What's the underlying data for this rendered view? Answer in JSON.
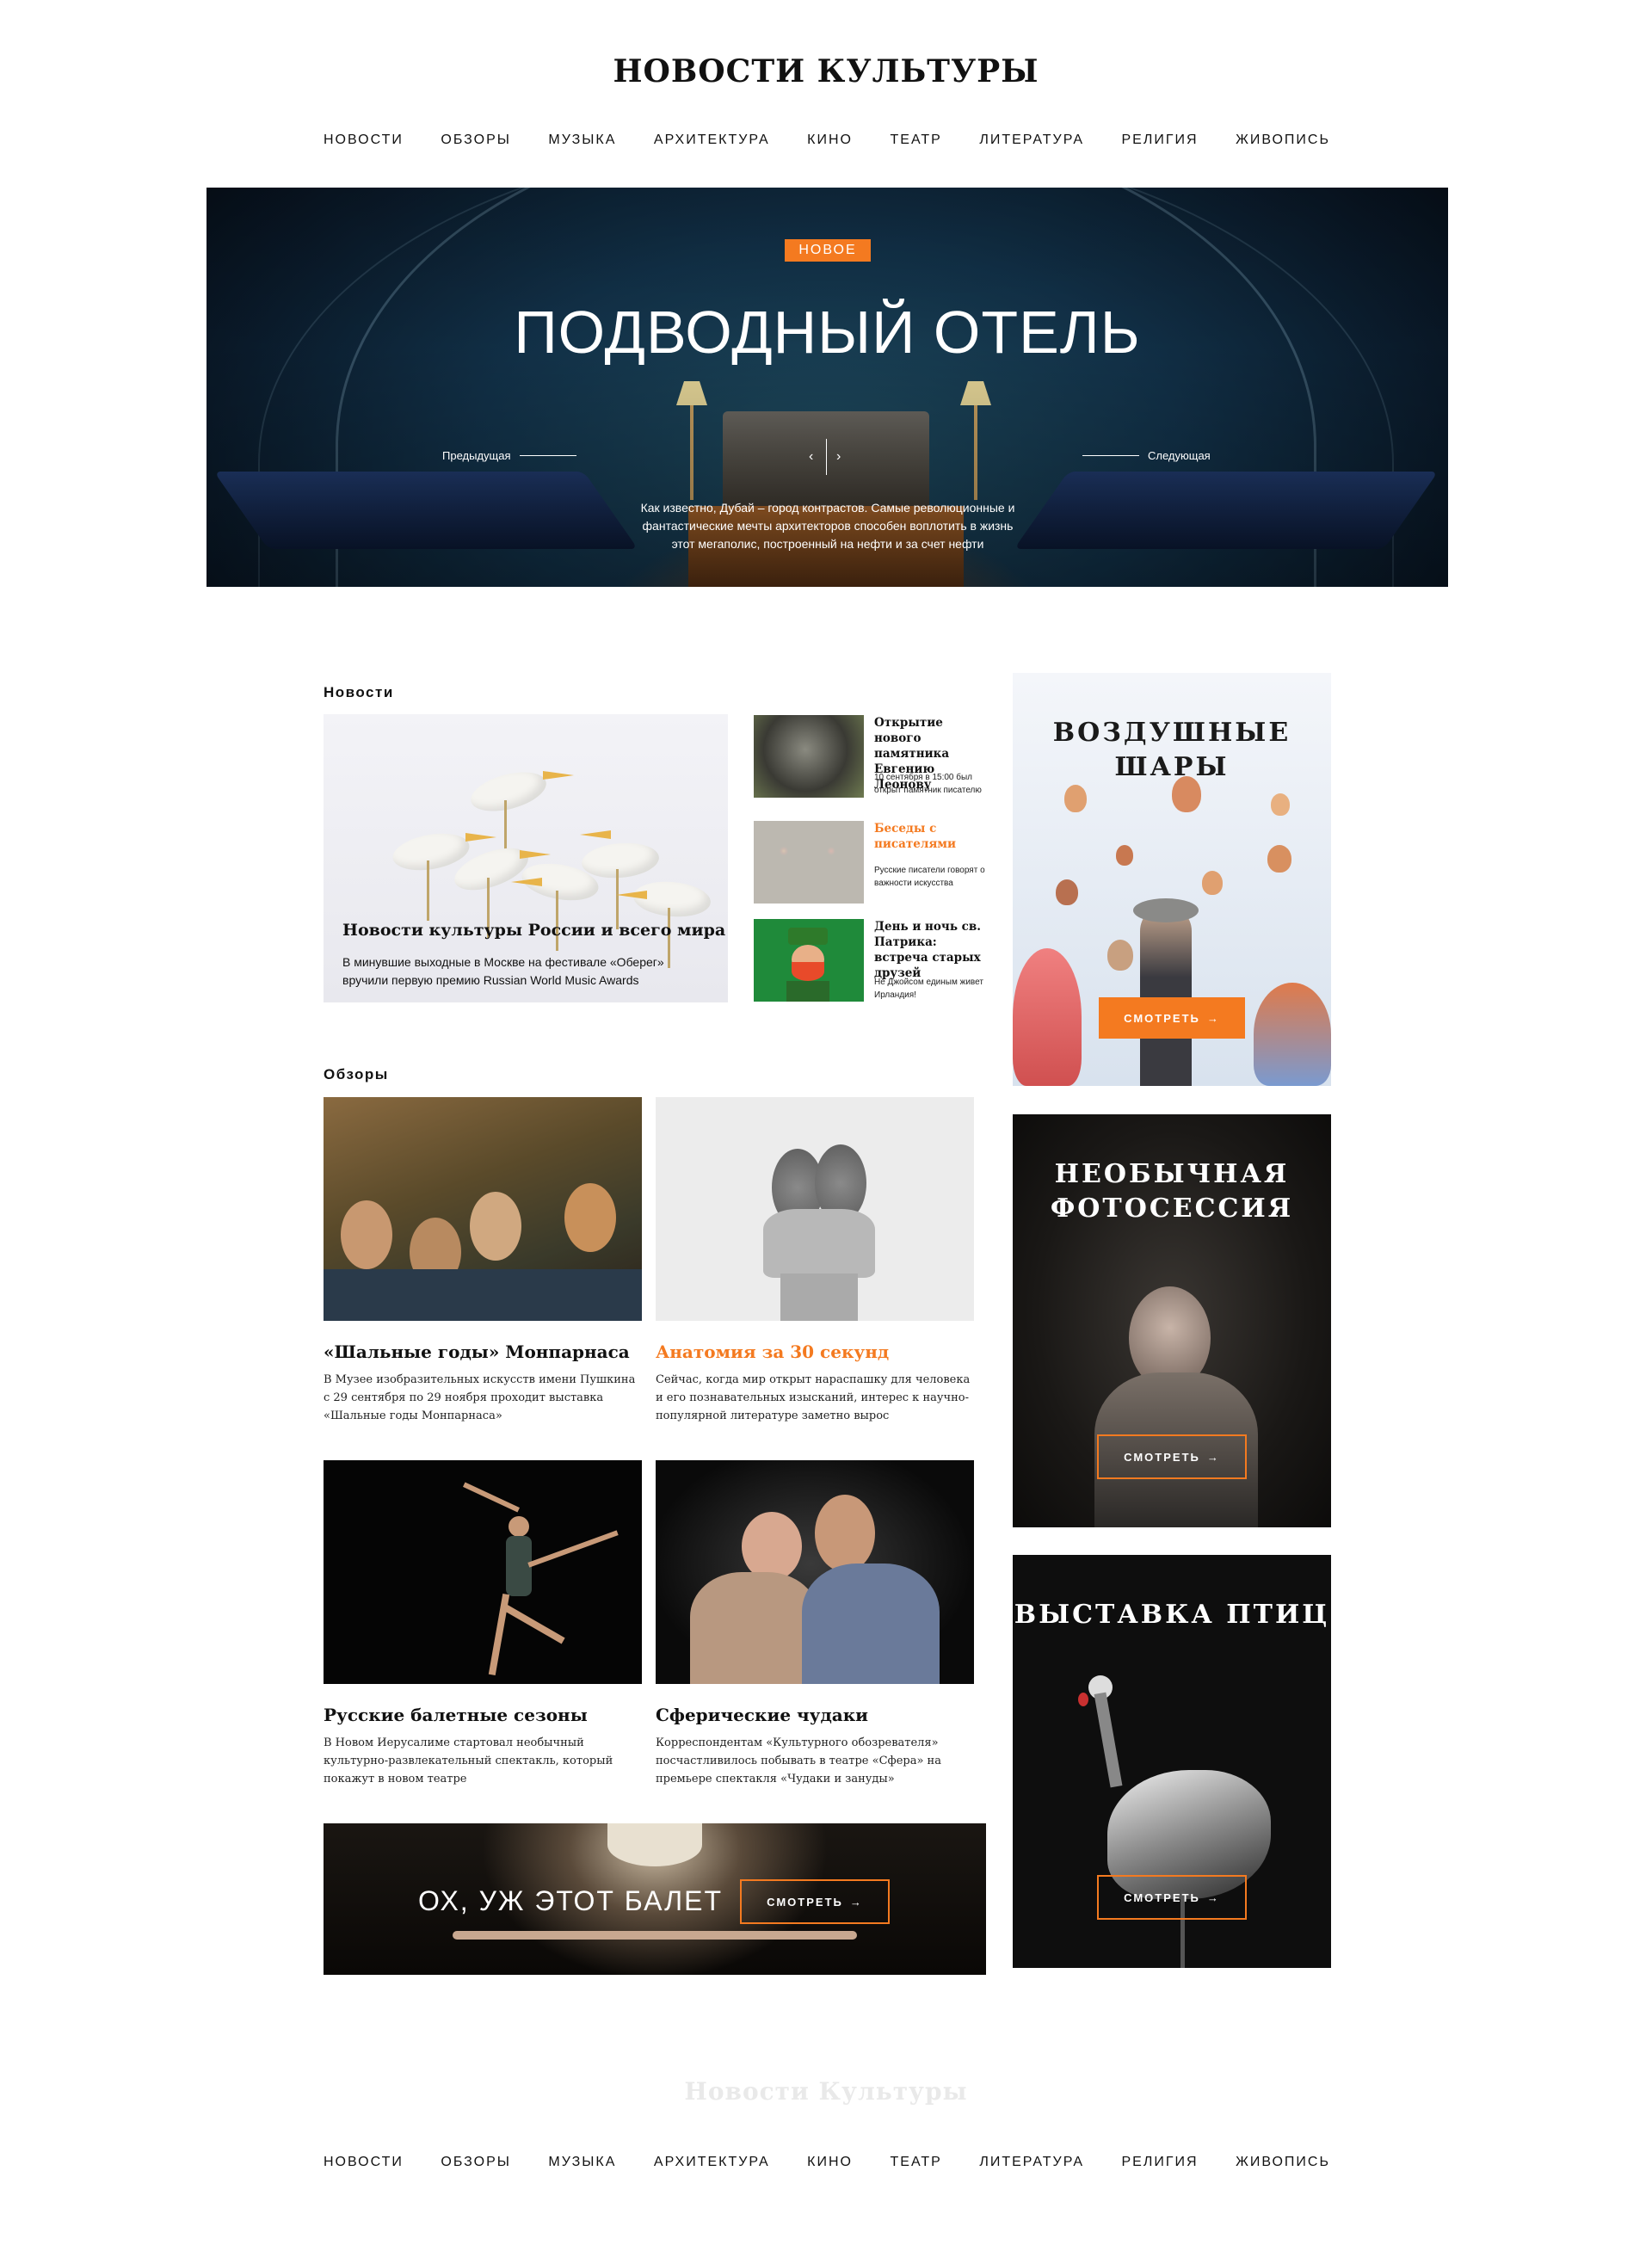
{
  "header": {
    "site_title": "НОВОСТИ КУЛЬТУРЫ"
  },
  "nav": [
    "НОВОСТИ",
    "ОБЗОРЫ",
    "МУЗЫКА",
    "АРХИТЕКТУРА",
    "КИНО",
    "ТЕАТР",
    "ЛИТЕРАТУРА",
    "РЕЛИГИЯ",
    "ЖИВОПИСЬ"
  ],
  "hero": {
    "badge": "НОВОЕ",
    "title": "ПОДВОДНЫЙ ОТЕЛЬ",
    "prev": "Предыдущая",
    "next": "Следующая",
    "prev_arrow": "‹",
    "next_arrow": "›",
    "description": "Как известно, Дубай – город контрастов. Самые революционные и фантастические мечты архитекторов способен воплотить в жизнь этот мегаполис, построенный на нефти и за счет нефти"
  },
  "news": {
    "heading": "Новости",
    "main": {
      "title": "Новости культуры России и всего мира",
      "description": "В минувшие выходные в Москве на фестивале «Оберег» вручили первую премию Russian World Music Awards"
    },
    "items": [
      {
        "title": "Открытие нового памятника Евгению Леонову",
        "subtitle": "10 сентября в 15:00 был открыт памятник писателю"
      },
      {
        "title": "Беседы с писателями",
        "subtitle": "Русские писатели говорят о важности искусства"
      },
      {
        "title": "День и ночь св. Патрика: встреча старых друзей",
        "subtitle": "Не Джойсом единым живет Ирландия!"
      }
    ]
  },
  "reviews": {
    "heading": "Обзоры",
    "items": [
      {
        "title": "«Шальные годы» Монпарнаса",
        "description": "В Музее изобразительных искусств имени Пушкина с 29 сентября по 29 ноября проходит выставка «Шальные годы Монпарнаса»"
      },
      {
        "title": "Анатомия за 30 секунд",
        "description": "Сейчас, когда мир открыт нараспашку для человека и его познавательных изысканий, интерес к научно-популярной литературе заметно вырос"
      },
      {
        "title": "Русские балетные сезоны",
        "description": "В Новом Иерусалиме стартовал необычный культурно-развлекательный спектакль, который покажут в новом театре"
      },
      {
        "title": "Сферические чудаки",
        "description": "Корреспондентам «Культурного обозревателя» посчастливилось побывать в театре «Сфера» на премьере спектакля «Чудаки и зануды»"
      }
    ],
    "banner": {
      "text": "ОХ, УЖ ЭТОТ БАЛЕТ",
      "button": "СМОТРЕТЬ"
    }
  },
  "sidebar": [
    {
      "title": "ВОЗДУШНЫЕ ШАРЫ",
      "button": "СМОТРЕТЬ"
    },
    {
      "title": "НЕОБЫЧНАЯ ФОТОСЕССИЯ",
      "button": "СМОТРЕТЬ"
    },
    {
      "title": "ВЫСТАВКА ПТИЦ",
      "button": "СМОТРЕТЬ"
    }
  ],
  "footer": {
    "title": "Новости Культуры"
  },
  "colors": {
    "accent": "#f47a20",
    "text": "#111111",
    "footer_title": "#e9e9e9"
  },
  "icons": {
    "button_arrow": "arrow-right-icon"
  }
}
